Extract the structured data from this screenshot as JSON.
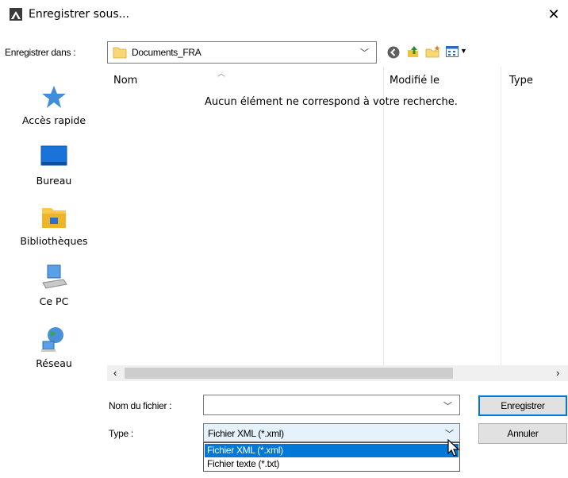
{
  "window": {
    "title": "Enregistrer sous...",
    "close": "✕"
  },
  "toolbar": {
    "save_in_label": "Enregistrer dans :",
    "folder": "Documents_FRA"
  },
  "places": [
    {
      "label": "Accès rapide",
      "icon": "star-icon"
    },
    {
      "label": "Bureau",
      "icon": "desktop-icon"
    },
    {
      "label": "Bibliothèques",
      "icon": "libraries-icon"
    },
    {
      "label": "Ce PC",
      "icon": "computer-icon"
    },
    {
      "label": "Réseau",
      "icon": "network-icon"
    }
  ],
  "file_list": {
    "columns": [
      "Nom",
      "Modifié le",
      "Type"
    ],
    "empty_message": "Aucun élément ne correspond à votre recherche."
  },
  "form": {
    "filename_label": "Nom du fichier :",
    "filename_value": "",
    "type_label": "Type :",
    "type_value": "Fichier XML (*.xml)",
    "type_options": [
      "Fichier XML (*.xml)",
      "Fichier texte (*.txt)"
    ],
    "save_button": "Enregistrer",
    "cancel_button": "Annuler"
  },
  "colors": {
    "accent": "#0078d7",
    "folder": "#f8d775"
  }
}
